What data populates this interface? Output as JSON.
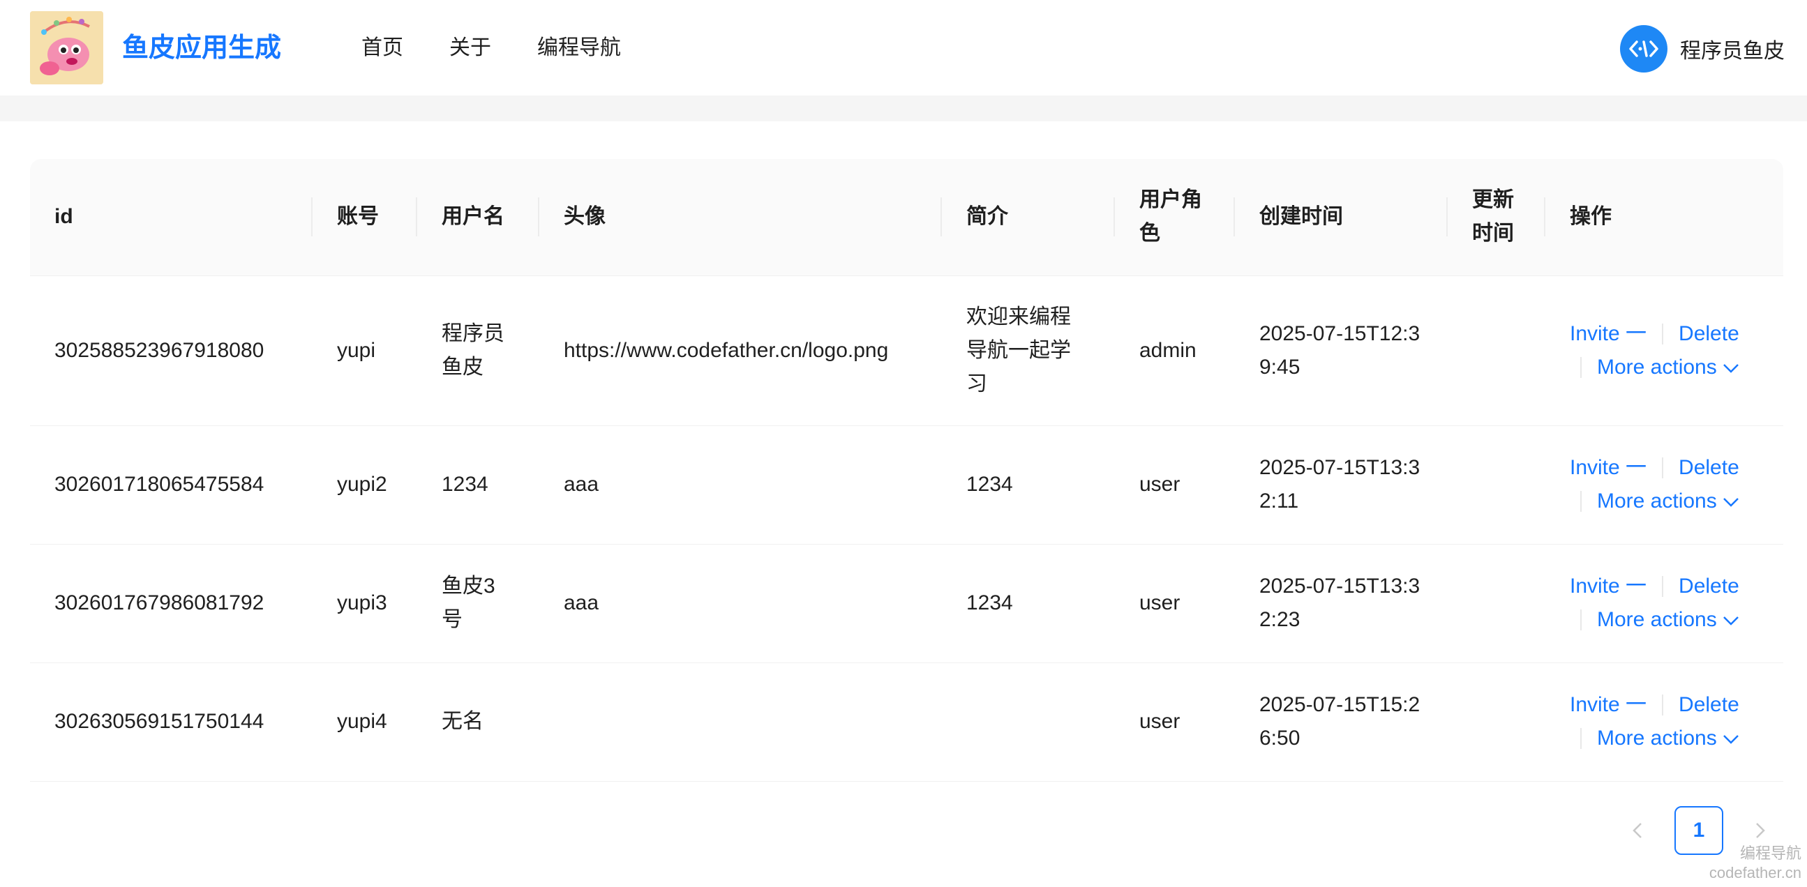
{
  "header": {
    "title": "鱼皮应用生成",
    "nav": [
      "首页",
      "关于",
      "编程导航"
    ],
    "user_name": "程序员鱼皮"
  },
  "table": {
    "columns": [
      "id",
      "账号",
      "用户名",
      "头像",
      "简介",
      "用户角色",
      "创建时间",
      "更新时间",
      "操作"
    ],
    "rows": [
      {
        "id": "302588523967918080",
        "account": "yupi",
        "username": "程序员鱼皮",
        "avatar": "https://www.codefather.cn/logo.png",
        "profile": "欢迎来编程导航一起学习",
        "role": "admin",
        "created": "2025-07-15T12:39:45",
        "updated": ""
      },
      {
        "id": "302601718065475584",
        "account": "yupi2",
        "username": "1234",
        "avatar": "aaa",
        "profile": "1234",
        "role": "user",
        "created": "2025-07-15T13:32:11",
        "updated": ""
      },
      {
        "id": "302601767986081792",
        "account": "yupi3",
        "username": "鱼皮3号",
        "avatar": "aaa",
        "profile": "1234",
        "role": "user",
        "created": "2025-07-15T13:32:23",
        "updated": ""
      },
      {
        "id": "302630569151750144",
        "account": "yupi4",
        "username": "无名",
        "avatar": "",
        "profile": "",
        "role": "user",
        "created": "2025-07-15T15:26:50",
        "updated": ""
      }
    ],
    "actions": {
      "invite": "Invite 一",
      "delete": "Delete",
      "more": "More actions"
    }
  },
  "pagination": {
    "current_page": "1"
  },
  "watermark": {
    "line1": "编程导航",
    "line2": "codefather.cn"
  },
  "colors": {
    "accent": "#1677ff",
    "header_bg": "#fafafa"
  }
}
